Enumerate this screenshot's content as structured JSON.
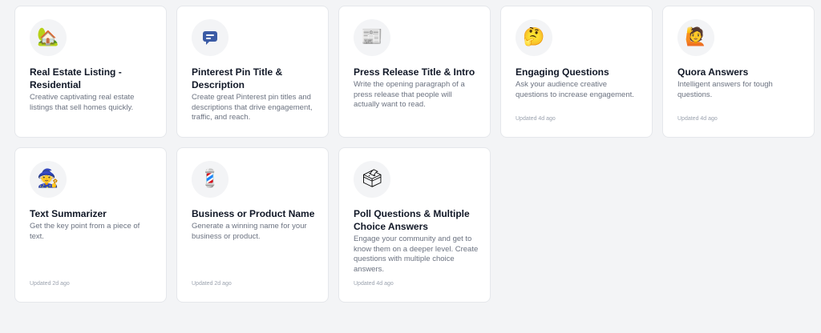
{
  "cards": [
    {
      "icon": "house-with-garden-icon",
      "glyph": "🏡",
      "title": "Real Estate Listing - Residential",
      "description": "Creative captivating real estate listings that sell homes quickly.",
      "updated": ""
    },
    {
      "icon": "speech-bubble-icon",
      "glyph": "",
      "title": "Pinterest Pin Title & Description",
      "description": "Create great Pinterest pin titles and descriptions that drive engagement, traffic, and reach.",
      "updated": ""
    },
    {
      "icon": "newspaper-icon",
      "glyph": "📰",
      "title": "Press Release Title & Intro",
      "description": "Write the opening paragraph of a press release that people will actually want to read.",
      "updated": ""
    },
    {
      "icon": "thinking-face-icon",
      "glyph": "🤔",
      "title": "Engaging Questions",
      "description": "Ask your audience creative questions to increase engagement.",
      "updated": "Updated 4d ago"
    },
    {
      "icon": "person-raising-hand-icon",
      "glyph": "🙋",
      "title": "Quora Answers",
      "description": "Intelligent answers for tough questions.",
      "updated": "Updated 4d ago"
    },
    {
      "icon": "mage-icon",
      "glyph": "🧙",
      "title": "Text Summarizer",
      "description": "Get the key point from a piece of text.",
      "updated": "Updated 2d ago"
    },
    {
      "icon": "barber-pole-icon",
      "glyph": "💈",
      "title": "Business or Product Name",
      "description": "Generate a winning name for your business or product.",
      "updated": "Updated 2d ago"
    },
    {
      "icon": "ballot-box-icon",
      "glyph": "🗳",
      "title": "Poll Questions & Multiple Choice Answers",
      "description": "Engage your community and get to know them on a deeper level. Create questions with multiple choice answers.",
      "updated": "Updated 4d ago"
    }
  ]
}
